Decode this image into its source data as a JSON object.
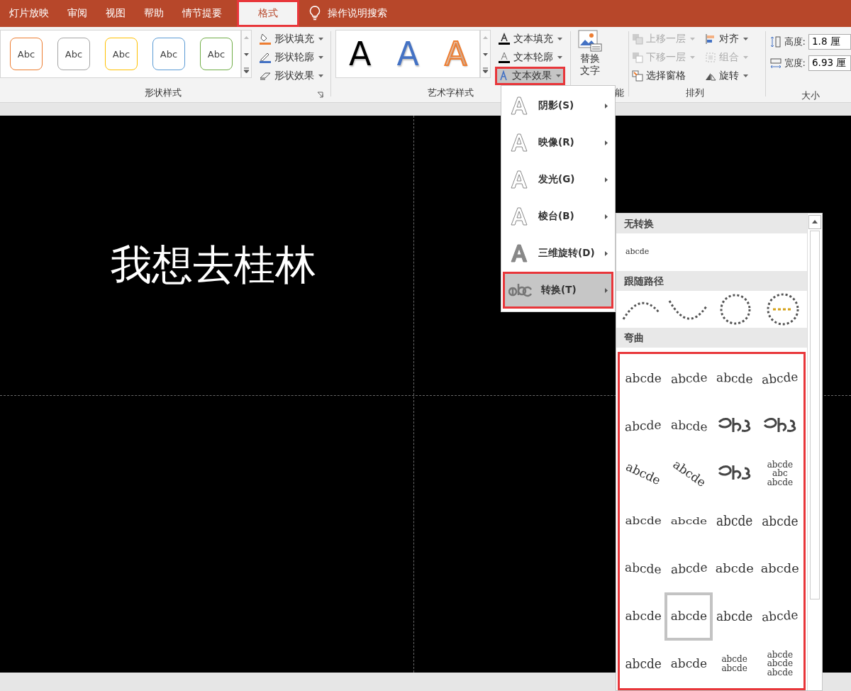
{
  "tabs": [
    {
      "label": "灯片放映",
      "selected": false,
      "highlighted": false
    },
    {
      "label": "审阅",
      "selected": false,
      "highlighted": false
    },
    {
      "label": "视图",
      "selected": false,
      "highlighted": false
    },
    {
      "label": "帮助",
      "selected": false,
      "highlighted": false
    },
    {
      "label": "情节提要",
      "selected": false,
      "highlighted": false
    },
    {
      "label": "格式",
      "selected": true,
      "highlighted": true
    }
  ],
  "tell_me": {
    "label": "操作说明搜索"
  },
  "ribbon": {
    "shape_styles": {
      "label": "形状样式",
      "presets": [
        {
          "label": "Abc",
          "color": "#ed7d31"
        },
        {
          "label": "Abc",
          "color": "#a5a5a5"
        },
        {
          "label": "Abc",
          "color": "#ffc000"
        },
        {
          "label": "Abc",
          "color": "#5b9bd5"
        },
        {
          "label": "Abc",
          "color": "#70ad47"
        }
      ],
      "commands": [
        {
          "label": "形状填充",
          "kind": "fill"
        },
        {
          "label": "形状轮廓",
          "kind": "outline"
        },
        {
          "label": "形状效果",
          "kind": "effect"
        }
      ]
    },
    "wordart_styles": {
      "label": "艺术字样式",
      "presets": [
        {
          "label": "A",
          "kind": "solid",
          "color": "#000000"
        },
        {
          "label": "A",
          "kind": "solid",
          "color": "#4472c4"
        },
        {
          "label": "A",
          "kind": "outlined",
          "color": "#ed7d31"
        }
      ],
      "commands": [
        {
          "label": "文本填充",
          "kind": "fill",
          "selected": false,
          "highlighted": false
        },
        {
          "label": "文本轮廓",
          "kind": "outline",
          "selected": false,
          "highlighted": false
        },
        {
          "label": "文本效果",
          "kind": "effect",
          "selected": true,
          "highlighted": true
        }
      ]
    },
    "accessibility": {
      "label": "能",
      "button_lines": [
        "替换",
        "文字"
      ]
    },
    "arrange": {
      "label": "排列",
      "columns": [
        [
          {
            "label": "上移一层",
            "kind": "forward",
            "disabled": true,
            "dropdown": true
          },
          {
            "label": "下移一层",
            "kind": "backward",
            "disabled": true,
            "dropdown": true
          },
          {
            "label": "选择窗格",
            "kind": "pane",
            "disabled": false,
            "dropdown": false
          }
        ],
        [
          {
            "label": "对齐",
            "kind": "align",
            "disabled": false,
            "dropdown": true
          },
          {
            "label": "组合",
            "kind": "group",
            "disabled": true,
            "dropdown": true
          },
          {
            "label": "旋转",
            "kind": "rotate",
            "disabled": false,
            "dropdown": true
          }
        ]
      ]
    },
    "size": {
      "label": "大小",
      "fields": [
        {
          "label": "高度:",
          "kind": "height",
          "value": "1.8 厘"
        },
        {
          "label": "宽度:",
          "kind": "width",
          "value": "6.93 厘"
        }
      ]
    }
  },
  "slide": {
    "text": "我想去桂林"
  },
  "text_effects_menu": {
    "items": [
      {
        "label": "阴影(S)",
        "kind": "shadow",
        "selected": false,
        "highlighted": false
      },
      {
        "label": "映像(R)",
        "kind": "reflection",
        "selected": false,
        "highlighted": false
      },
      {
        "label": "发光(G)",
        "kind": "glow",
        "selected": false,
        "highlighted": false
      },
      {
        "label": "棱台(B)",
        "kind": "bevel",
        "selected": false,
        "highlighted": false
      },
      {
        "label": "三维旋转(D)",
        "kind": "rotation",
        "selected": false,
        "highlighted": false
      },
      {
        "label": "转换(T)",
        "kind": "transform",
        "selected": true,
        "highlighted": true
      }
    ]
  },
  "transform_gallery": {
    "sections": [
      {
        "title": "无转换",
        "kind": "plain",
        "highlighted": false,
        "items": [
          {
            "kind": "text",
            "lines": [
              "abcde"
            ],
            "selected": false
          }
        ]
      },
      {
        "title": "跟随路径",
        "kind": "path",
        "highlighted": false,
        "items": [
          {
            "kind": "arch"
          },
          {
            "kind": "arch-down"
          },
          {
            "kind": "circle"
          },
          {
            "kind": "button"
          }
        ]
      },
      {
        "title": "弯曲",
        "kind": "warp",
        "highlighted": true,
        "items": [
          {
            "kind": "text",
            "lines": [
              "abcde"
            ],
            "selected": false
          },
          {
            "kind": "text",
            "lines": [
              "abcde"
            ],
            "selected": false
          },
          {
            "kind": "text",
            "lines": [
              "abcde"
            ],
            "selected": false
          },
          {
            "kind": "text",
            "lines": [
              "abcde"
            ],
            "selected": false
          },
          {
            "kind": "text",
            "lines": [
              "abcde"
            ],
            "selected": false
          },
          {
            "kind": "text",
            "lines": [
              "abcde"
            ],
            "selected": false
          },
          {
            "kind": "glyph-art"
          },
          {
            "kind": "glyph-art"
          },
          {
            "kind": "text",
            "lines": [
              "abcde"
            ],
            "selected": false
          },
          {
            "kind": "text",
            "lines": [
              "abcde"
            ],
            "selected": false
          },
          {
            "kind": "glyph-art"
          },
          {
            "kind": "text",
            "lines": [
              "abcde",
              "abc",
              "abcde"
            ],
            "selected": false
          },
          {
            "kind": "text",
            "lines": [
              "abcde"
            ],
            "selected": false
          },
          {
            "kind": "text",
            "lines": [
              "abcde"
            ],
            "selected": false
          },
          {
            "kind": "text",
            "lines": [
              "abcde"
            ],
            "selected": false
          },
          {
            "kind": "text",
            "lines": [
              "abcde"
            ],
            "selected": false
          },
          {
            "kind": "text",
            "lines": [
              "abcde"
            ],
            "selected": false
          },
          {
            "kind": "text",
            "lines": [
              "abcde"
            ],
            "selected": false
          },
          {
            "kind": "text",
            "lines": [
              "abcde"
            ],
            "selected": false
          },
          {
            "kind": "text",
            "lines": [
              "abcde"
            ],
            "selected": false
          },
          {
            "kind": "text",
            "lines": [
              "abcde"
            ],
            "selected": false
          },
          {
            "kind": "text",
            "lines": [
              "abcde"
            ],
            "selected": true
          },
          {
            "kind": "text",
            "lines": [
              "abcde"
            ],
            "selected": false
          },
          {
            "kind": "text",
            "lines": [
              "abcde"
            ],
            "selected": false
          },
          {
            "kind": "text",
            "lines": [
              "abcde"
            ],
            "selected": false
          },
          {
            "kind": "text",
            "lines": [
              "abcde"
            ],
            "selected": false
          },
          {
            "kind": "text",
            "lines": [
              "abcde",
              "abcde"
            ],
            "selected": false
          },
          {
            "kind": "text",
            "lines": [
              "abcde",
              "abcde",
              "abcde"
            ],
            "selected": false
          }
        ]
      }
    ]
  }
}
